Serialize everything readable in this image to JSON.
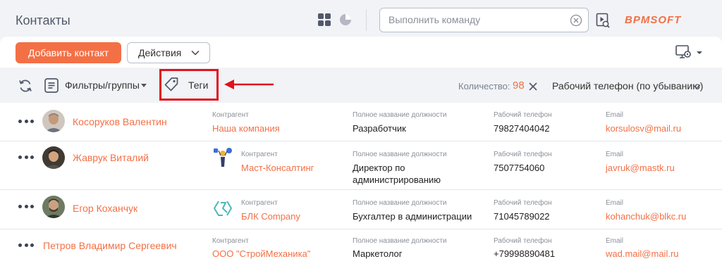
{
  "header": {
    "title": "Контакты",
    "command_placeholder": "Выполнить команду",
    "logo_text": "BPMSOFT"
  },
  "toolbar": {
    "add_label": "Добавить контакт",
    "actions_label": "Действия"
  },
  "filters": {
    "filters_label": "Фильтры/группы",
    "tags_label": "Теги",
    "count_label": "Количество:",
    "count_value": "98",
    "sort_label": "Рабочий телефон (по убыванию)"
  },
  "columns": {
    "account": "Контрагент",
    "job": "Полное название должности",
    "phone": "Рабочий телефон",
    "email": "Email"
  },
  "contacts": [
    {
      "name": "Косоруков Валентин",
      "account": "Наша компания",
      "job": "Разработчик",
      "job2": "",
      "phone": "79827404042",
      "email": "korsulosv@mail.ru"
    },
    {
      "name": "Жаврук Виталий",
      "account": "Маст-Консалтинг",
      "job": "Директор по",
      "job2": "администрированию",
      "phone": "7507754060",
      "email": "javruk@mastk.ru"
    },
    {
      "name": "Егор Коханчук",
      "account": "БЛК Company",
      "job": "Бухгалтер в администрации",
      "job2": "",
      "phone": "71045789022",
      "email": "kohanchuk@blkc.ru"
    },
    {
      "name": "Петров Владимир Сергеевич",
      "account": "ООО \"СтройМеханика\"",
      "job": "Маркетолог",
      "job2": "",
      "phone": "+79998890481",
      "email": "wad.mail@mail.ru"
    }
  ],
  "colors": {
    "accent": "#f37046",
    "highlight": "#e1121c",
    "background": "#f1f3f6"
  }
}
